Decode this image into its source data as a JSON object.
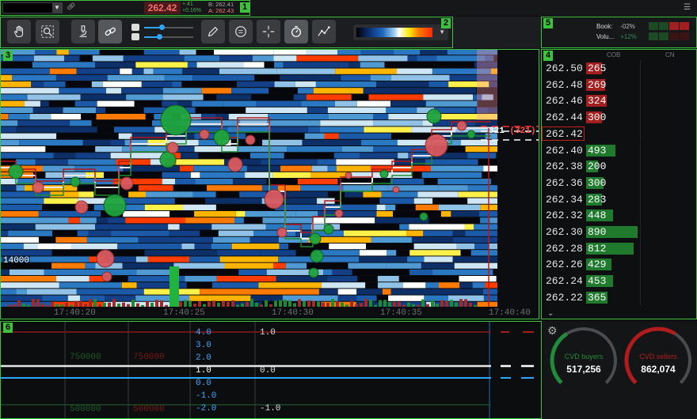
{
  "topbar": {
    "symbol": "",
    "last_price": "262.42",
    "change_abs": "+.41",
    "change_pct": "+0.16%",
    "bid": "B: 262.41",
    "ask": "A: 262.43"
  },
  "toolbar": {
    "tools": [
      "hand-tool-icon",
      "zoom-tool-icon",
      "microscope-icon",
      "link-icon",
      "pencil-icon",
      "comment-icon",
      "crosshair-icon",
      "stopwatch-icon",
      "line-chart-icon"
    ],
    "slider_1_level": 0.35,
    "slider_2_level": 0.3,
    "colormap": "heatmap-gradient"
  },
  "summary": {
    "book_label": "Book:",
    "book_value": "-02%",
    "volume_label": "Volu...",
    "volume_value": "+12%"
  },
  "heatmap": {
    "time_ticks": [
      "17:40:20",
      "17:40:25",
      "17:40:30",
      "17:40:35",
      "17:40:40"
    ],
    "level_label": "14000",
    "last_trade_size": "321",
    "last_trade_size_paren": "(321)"
  },
  "ladder": {
    "columns": [
      "COB",
      "CN"
    ],
    "rows": [
      {
        "price": "262.50",
        "size": "265",
        "side": "ask",
        "bar": 0.3
      },
      {
        "price": "262.48",
        "size": "269",
        "side": "ask",
        "bar": 0.35
      },
      {
        "price": "262.46",
        "size": "324",
        "side": "ask",
        "bar": 0.38
      },
      {
        "price": "262.44",
        "size": "300",
        "side": "ask",
        "bar": 0.3
      },
      {
        "price": "262.42",
        "size": "",
        "side": "current",
        "bar": 0
      },
      {
        "price": "262.40",
        "size": "493",
        "side": "bid",
        "bar": 0.55
      },
      {
        "price": "262.38",
        "size": "200",
        "side": "bid",
        "bar": 0.22
      },
      {
        "price": "262.36",
        "size": "300",
        "side": "bid",
        "bar": 0.33
      },
      {
        "price": "262.34",
        "size": "283",
        "side": "bid",
        "bar": 0.3
      },
      {
        "price": "262.32",
        "size": "448",
        "side": "bid",
        "bar": 0.5
      },
      {
        "price": "262.30",
        "size": "890",
        "side": "bid",
        "bar": 0.95
      },
      {
        "price": "262.28",
        "size": "812",
        "side": "bid",
        "bar": 0.88
      },
      {
        "price": "262.26",
        "size": "429",
        "side": "bid",
        "bar": 0.47
      },
      {
        "price": "262.24",
        "size": "453",
        "side": "bid",
        "bar": 0.5
      },
      {
        "price": "262.22",
        "size": "365",
        "side": "bid",
        "bar": 0.4
      }
    ]
  },
  "indicator": {
    "left_labels": [
      "750000",
      "750000",
      "500000",
      "500000"
    ],
    "mid_scale": [
      "4.0",
      "3.0",
      "2.0",
      "1.0",
      "0.0",
      "-1.0",
      "-2.0"
    ],
    "right_scale": [
      "1.0",
      "0.0",
      "-1.0"
    ]
  },
  "gauges": {
    "buyers_title": "CVD buyers",
    "buyers_value": "517,256",
    "sellers_title": "CVD sellers",
    "sellers_value": "862,074",
    "buyers_fraction": 0.38,
    "sellers_fraction": 0.62,
    "buyers_color": "#1e8c3a",
    "sellers_color": "#b01c1c"
  },
  "colors": {
    "accent_green": "#3cc23c",
    "bid": "#1f7a2e",
    "ask": "#a31f1f"
  }
}
